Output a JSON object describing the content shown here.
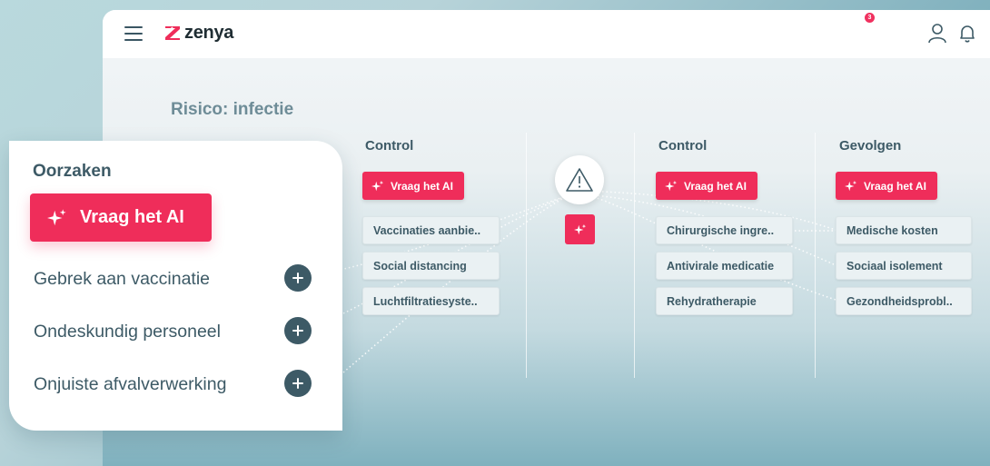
{
  "app": {
    "logo_text": "zenya",
    "notification_count": "3",
    "risk_title": "Risico: infectie"
  },
  "colors": {
    "accent": "#ef2d5a",
    "primary_text": "#3d5a66",
    "muted_title": "#6e8c97"
  },
  "columns": [
    {
      "header": "Control",
      "ai_label": "Vraag het AI",
      "items": [
        "Vaccinaties aanbie..",
        "Social distancing",
        "Luchtfiltratiesyste.."
      ]
    },
    {
      "header": "Control",
      "ai_label": "Vraag het AI",
      "items": [
        "Chirurgische ingre..",
        "Antivirale medicatie",
        "Rehydratherapie"
      ]
    },
    {
      "header": "Gevolgen",
      "ai_label": "Vraag het AI",
      "items": [
        "Medische kosten",
        "Sociaal isolement",
        "Gezondheidsprobl.."
      ]
    }
  ],
  "causes_panel": {
    "title": "Oorzaken",
    "ai_label": "Vraag het AI",
    "items": [
      "Gebrek aan vaccinatie",
      "Ondeskundig personeel",
      "Onjuiste afvalverwerking"
    ]
  },
  "icons": [
    "menu-icon",
    "user-icon",
    "bell-icon",
    "warning-triangle-icon",
    "sparkle-icon",
    "plus-icon"
  ]
}
